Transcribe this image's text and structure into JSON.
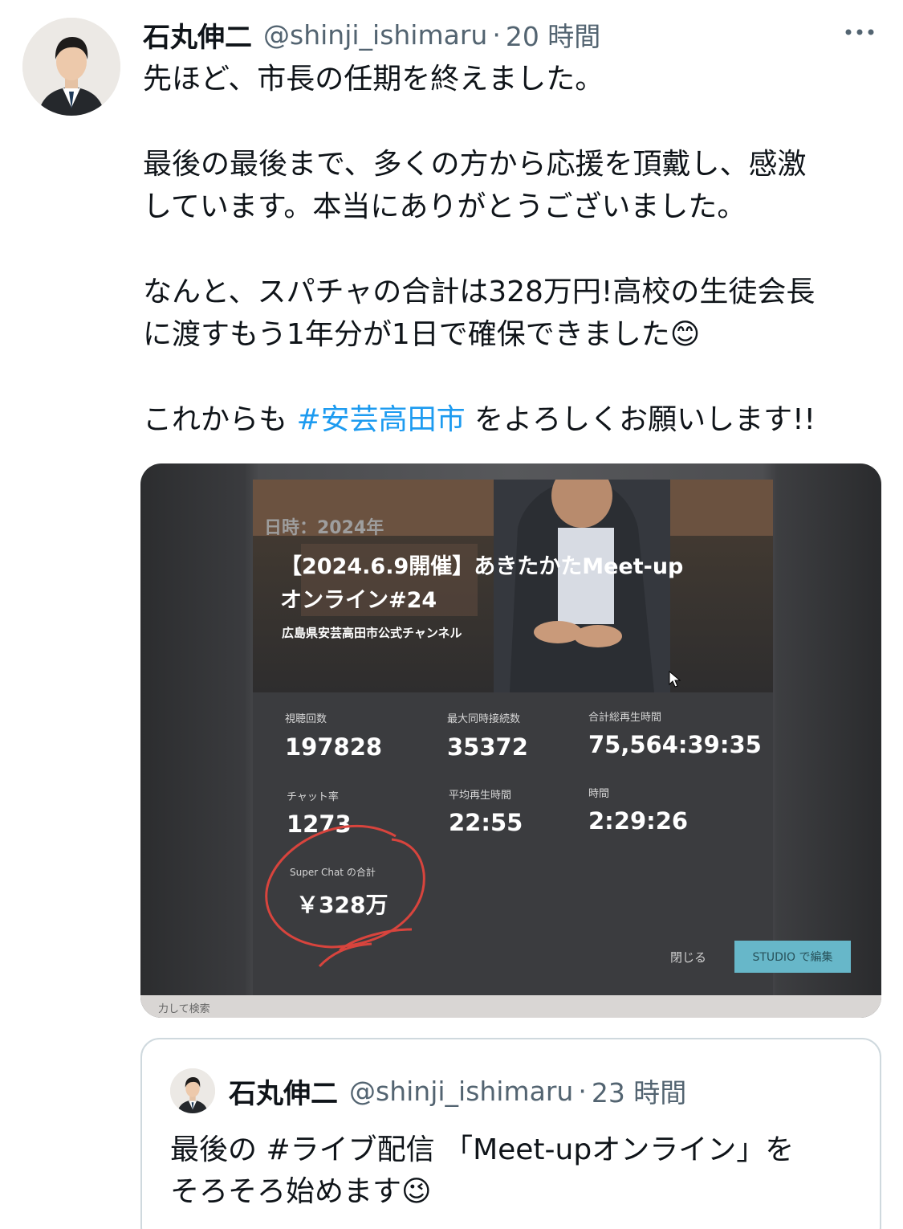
{
  "tweet": {
    "author_name": "石丸伸二",
    "author_handle": "@shinji_ishimaru",
    "separator": "·",
    "time": "20 時間",
    "more_icon": "more-horizontal-icon",
    "lines": [
      "先ほど、市長の任期を終えました。",
      "",
      "最後の最後まで、多くの方から応援を頂戴し、感激",
      "しています。本当にありがとうございました。",
      "",
      "なんと、スパチャの合計は328万円!高校の生徒会長",
      "に渡すもう1年分が1日で確保できました😊",
      ""
    ],
    "last_line_prefix": "これからも ",
    "hashtag": "#安芸高田市",
    "last_line_suffix": " をよろしくお願いします!!",
    "link_color": "#1d9bf0"
  },
  "media": {
    "overlay_date": "日時：2024年",
    "overlay_title_1": "【2024.6.9開催】あきたかたMeet-up",
    "overlay_title_2": "オンライン#24",
    "overlay_channel": "広島県安芸高田市公式チャンネル",
    "stats": [
      {
        "label": "視聴回数",
        "value": "197828"
      },
      {
        "label": "最大同時接続数",
        "value": "35372"
      },
      {
        "label": "合計総再生時間",
        "value": "75,564:39:35"
      },
      {
        "label": "チャット率",
        "value": "1273"
      },
      {
        "label": "平均再生時間",
        "value": "22:55"
      },
      {
        "label": "時間",
        "value": "2:29:26"
      }
    ],
    "superchat_label": "Super Chat の合計",
    "superchat_value": "￥328万",
    "close_label": "閉じる",
    "studio_label": "STUDIO で編集",
    "taskbar_text": "力して検索"
  },
  "quoted": {
    "author_name": "石丸伸二",
    "author_handle": "@shinji_ishimaru",
    "separator": "·",
    "time": "23 時間",
    "line1_prefix": "最後の ",
    "hashtag": "#ライブ配信",
    "line1_suffix": " 「Meet-upオンライン」を",
    "line2": "そろそろ始めます😉"
  }
}
